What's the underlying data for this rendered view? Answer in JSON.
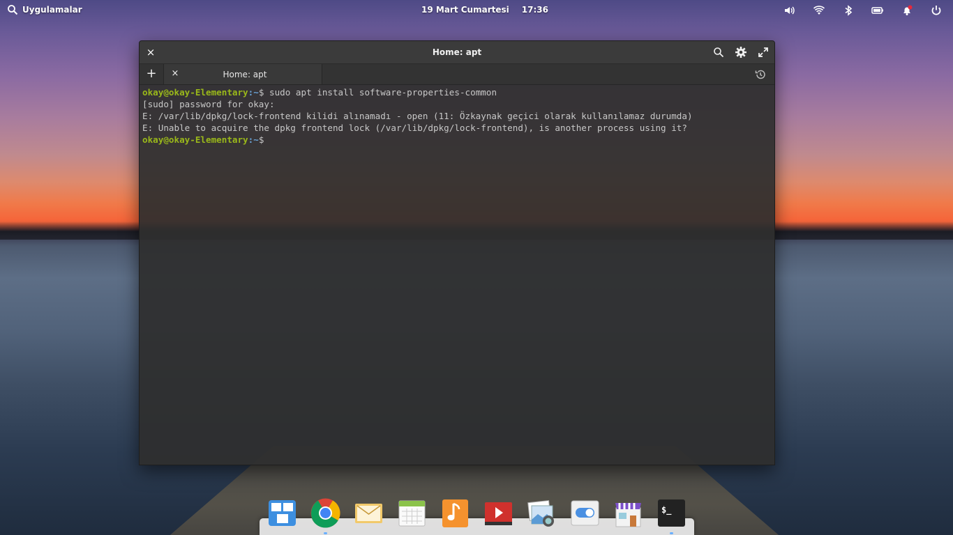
{
  "panel": {
    "apps_label": "Uygulamalar",
    "date": "19 Mart Cumartesi",
    "time": "17:36",
    "indicators": [
      "volume-icon",
      "wifi-icon",
      "bluetooth-icon",
      "battery-icon",
      "notification-icon",
      "power-icon"
    ]
  },
  "window": {
    "title": "Home: apt",
    "tab_label": "Home: apt",
    "new_tab_label": "+",
    "close_label": "×"
  },
  "terminal": {
    "line1_user": "okay@okay-Elementary",
    "line1_path": ":~",
    "line1_cmd": "$ sudo apt install software-properties-common",
    "line2": "[sudo] password for okay:",
    "line3": "E: /var/lib/dpkg/lock-frontend kilidi alınamadı - open (11: Özkaynak geçici olarak kullanılamaz durumda)",
    "line4": "E: Unable to acquire the dpkg frontend lock (/var/lib/dpkg/lock-frontend), is another process using it?",
    "line5_user": "okay@okay-Elementary",
    "line5_path": ":~",
    "line5_sym": "$"
  },
  "dock": {
    "items": [
      "multitasking-view",
      "chrome",
      "mail",
      "calendar",
      "music",
      "videos",
      "photos",
      "system-settings",
      "appcenter",
      "terminal"
    ]
  }
}
